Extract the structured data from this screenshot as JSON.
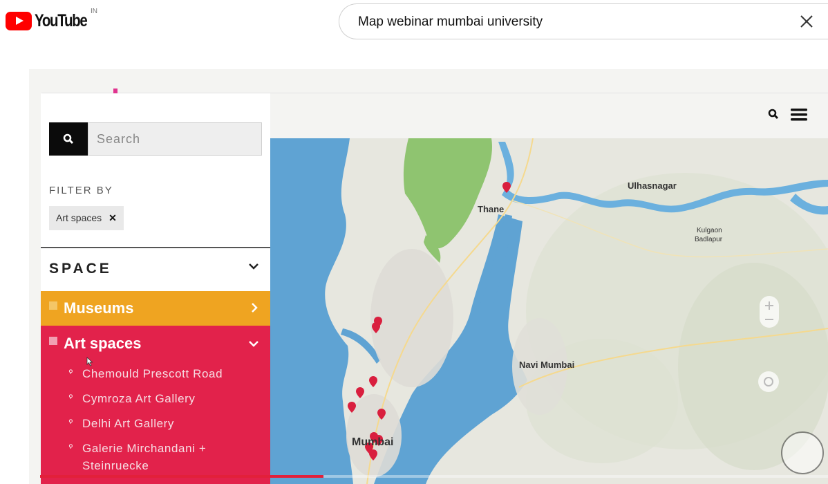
{
  "youtube": {
    "logo_text": "YouTube",
    "country_code": "IN",
    "search_query": "Map webinar mumbai university"
  },
  "sidebar": {
    "search_placeholder": "Search",
    "filter_label": "FILTER BY",
    "active_filter": "Art spaces",
    "section_title": "SPACE",
    "categories": [
      {
        "label": "Museums",
        "color": "#efa421"
      },
      {
        "label": "Art spaces",
        "color": "#e2224b"
      }
    ],
    "venues": [
      "Chemould Prescott Road",
      "Cymroza Art Gallery",
      "Delhi Art Gallery",
      "Galerie Mirchandani +",
      "Steinruecke"
    ]
  },
  "map": {
    "labels": {
      "thane": "Thane",
      "ulhasnagar": "Ulhasnagar",
      "navi_mumbai": "Navi Mumbai",
      "mumbai": "Mumbai",
      "kulgaon": "Kulgaon",
      "badlapur": "Badlapur"
    }
  },
  "player": {
    "progress": 0.36
  },
  "colors": {
    "youtube_red": "#ff0000",
    "museums": "#efa421",
    "art_spaces": "#e2224b",
    "water": "#5fa3d3"
  }
}
